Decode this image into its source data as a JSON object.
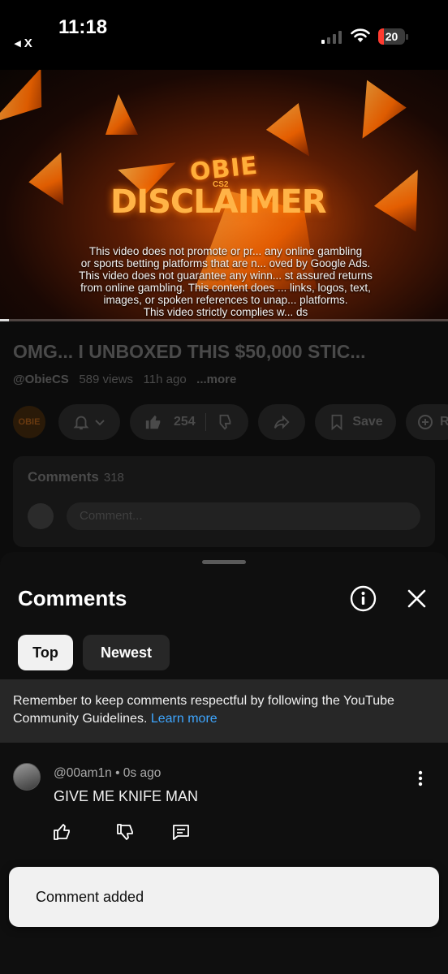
{
  "status_bar": {
    "time": "11:18",
    "back_label": "◂ X",
    "battery": "20",
    "battery_color": "#ff3b30"
  },
  "video": {
    "brand": "OBIE",
    "brand_sub": "CS2",
    "headline": "DISCLAIMER",
    "disclaimer_lines": [
      "This video does not promote or pr... any online gambling",
      "or sports betting platforms that are n... oved by Google Ads.",
      "This video does not guarantee any winn... st assured returns",
      "from online gambling. This content does ... links, logos, text,",
      "images, or spoken references to unap... platforms.",
      "This video strictly complies w... ds"
    ],
    "progress": 0.02
  },
  "video_info": {
    "title": "OMG... I UNBOXED THIS $50,000 STIC...",
    "channel": "@ObieCS",
    "views": "589 views",
    "age": "11h ago",
    "more": "...more",
    "channel_avatar_text": "OBIE"
  },
  "actions": {
    "like_count": "254",
    "save_label": "Save",
    "remix_label": "R"
  },
  "comments_preview": {
    "label": "Comments",
    "count": "318",
    "placeholder": "Comment..."
  },
  "sheet": {
    "title": "Comments",
    "tabs": [
      {
        "label": "Top",
        "selected": true
      },
      {
        "label": "Newest",
        "selected": false
      }
    ],
    "notice_text": "Remember to keep comments respectful by following the YouTube Community Guidelines.",
    "notice_link": "Learn more",
    "comment": {
      "author": "@00am1n",
      "time": "0s ago",
      "text": "GIVE ME KNIFE MAN"
    }
  },
  "toast": "Comment added",
  "colors": {
    "link": "#3ea6ff",
    "sheet_bg": "#0f0f0f",
    "chip_selected": "#f1f1f1"
  }
}
